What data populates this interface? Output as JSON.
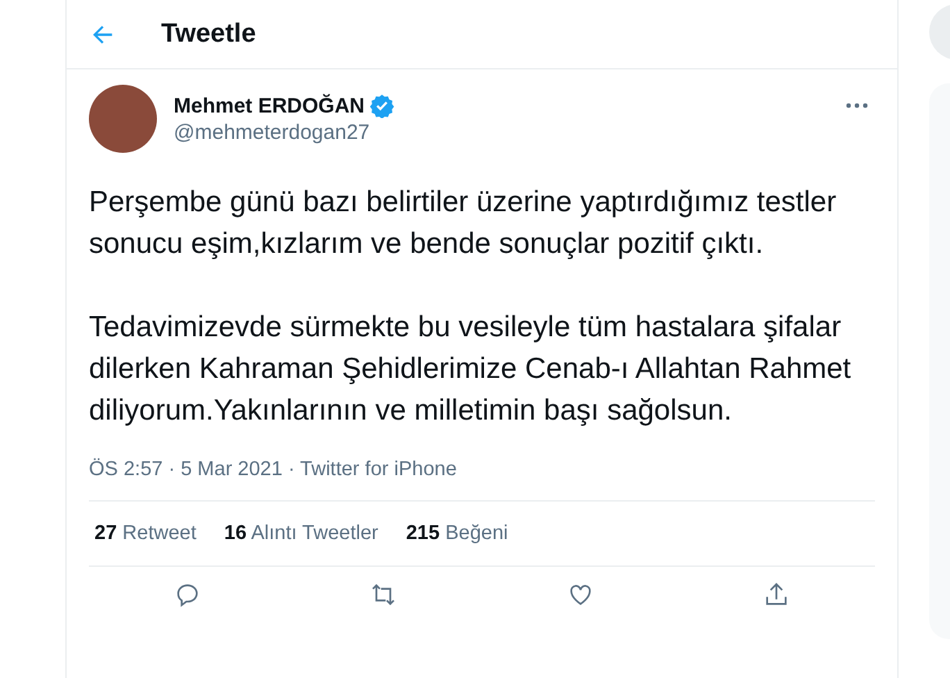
{
  "header": {
    "title": "Tweetle"
  },
  "tweet": {
    "author": {
      "name": "Mehmet ERDOĞAN",
      "verified": true,
      "handle": "@mehmeterdogan27"
    },
    "paragraphs": [
      "Perşembe günü bazı belirtiler üzerine yaptırdığımız testler sonucu eşim,kızlarım ve bende sonuçlar pozitif çıktı.",
      "Tedavimizevde sürmekte bu vesileyle tüm hastalara şifalar dilerken Kahraman Şehidlerimize Cenab-ı Allahtan Rahmet diliyorum.Yakınlarının ve milletimin başı sağolsun."
    ],
    "meta": "ÖS 2:57 · 5 Mar 2021 · Twitter for iPhone",
    "stats": [
      "**27** Retweet",
      "**16** Alıntı Tweetler",
      "**215** Beğeni"
    ],
    "actions": [
      {
        "kind": "reply"
      },
      {
        "kind": "retweet"
      },
      {
        "kind": "like"
      },
      {
        "kind": "share"
      }
    ]
  }
}
